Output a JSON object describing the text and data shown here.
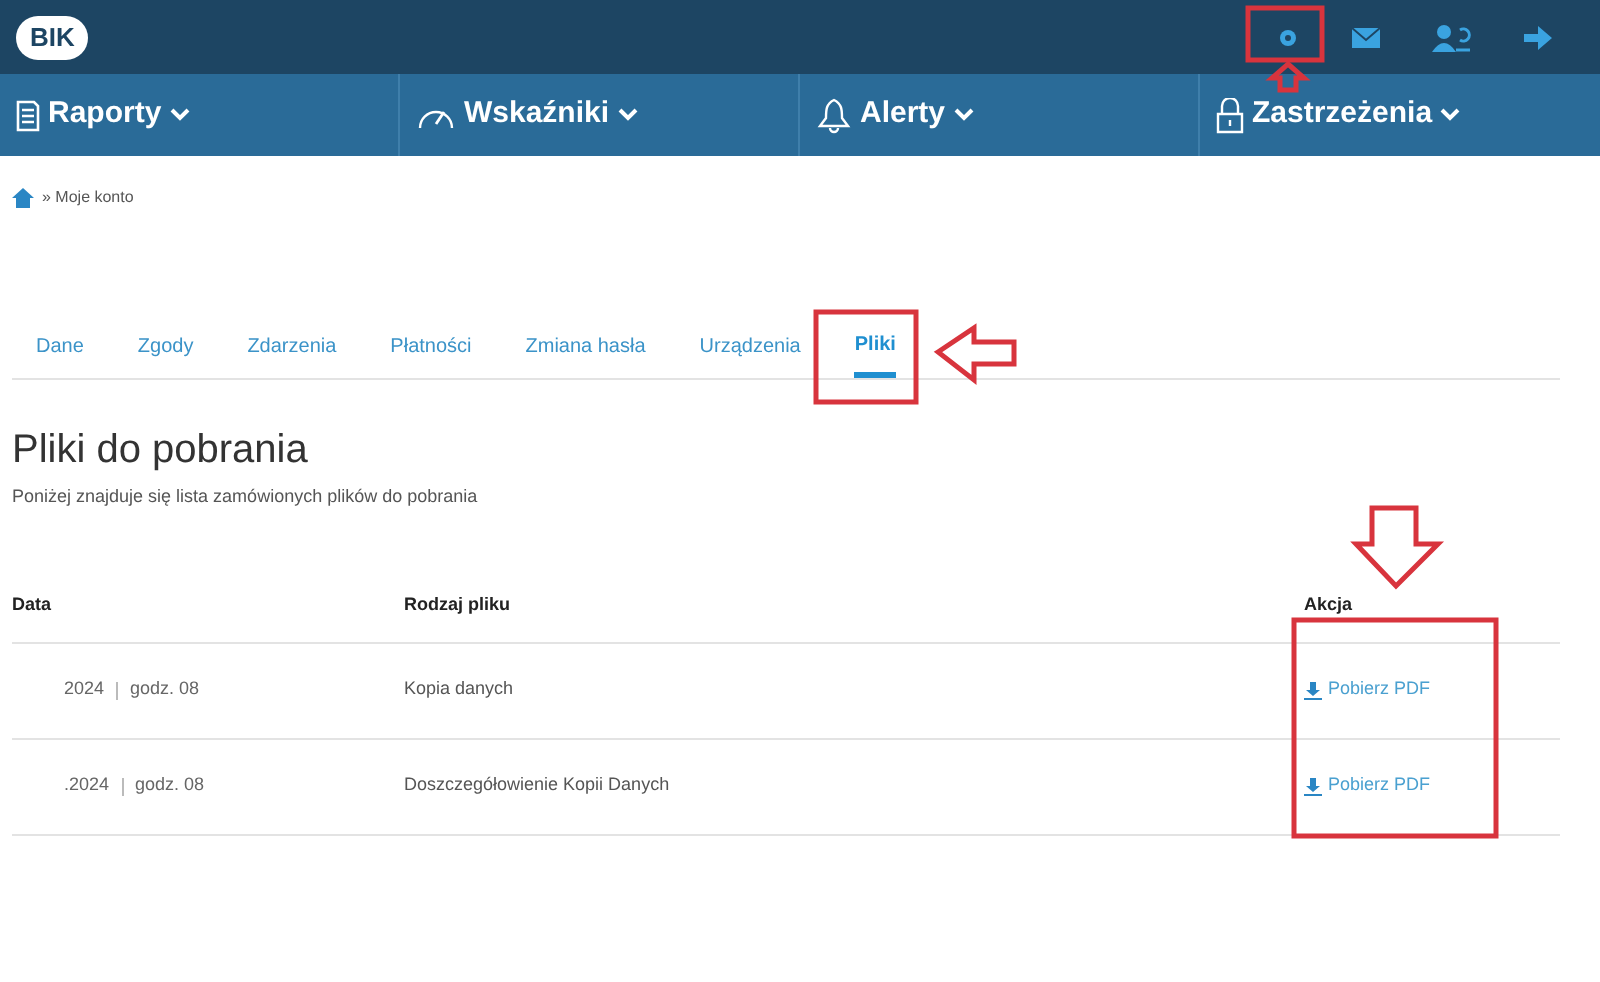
{
  "header": {
    "logo": "BIK"
  },
  "nav": [
    {
      "label": "Raporty"
    },
    {
      "label": "Wskaźniki"
    },
    {
      "label": "Alerty"
    },
    {
      "label": "Zastrzeżenia"
    }
  ],
  "breadcrumb": "» Moje konto",
  "tabs": [
    {
      "label": "Dane",
      "selected": false
    },
    {
      "label": "Zgody",
      "selected": false
    },
    {
      "label": "Zdarzenia",
      "selected": false
    },
    {
      "label": "Płatności",
      "selected": false
    },
    {
      "label": "Zmiana hasła",
      "selected": false
    },
    {
      "label": "Urządzenia",
      "selected": false
    },
    {
      "label": "Pliki",
      "selected": true
    }
  ],
  "title": "Pliki do pobrania",
  "subtitle": "Poniżej znajduje się lista zamówionych plików do pobrania",
  "table": {
    "columns": [
      "Data",
      "Rodzaj pliku",
      "Akcja"
    ],
    "rows": [
      {
        "date": "2024",
        "time": "godz. 08",
        "type": "Kopia danych",
        "action": "Pobierz PDF"
      },
      {
        "date": ".2024",
        "time": "godz. 08",
        "type": "Doszczegółowienie Kopii Danych",
        "action": "Pobierz PDF"
      }
    ]
  }
}
